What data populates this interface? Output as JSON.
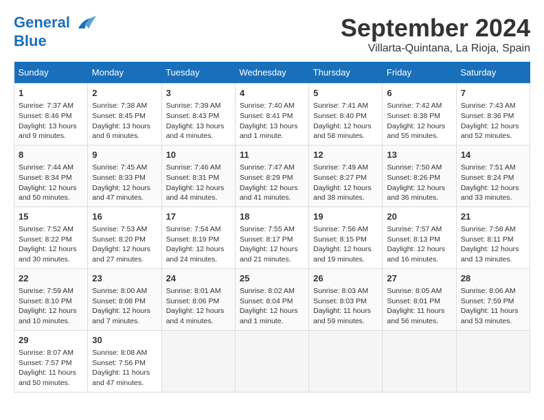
{
  "header": {
    "logo_line1": "General",
    "logo_line2": "Blue",
    "month_title": "September 2024",
    "location": "Villarta-Quintana, La Rioja, Spain"
  },
  "calendar": {
    "days_of_week": [
      "Sunday",
      "Monday",
      "Tuesday",
      "Wednesday",
      "Thursday",
      "Friday",
      "Saturday"
    ],
    "weeks": [
      [
        {
          "day": "1",
          "sunrise": "Sunrise: 7:37 AM",
          "sunset": "Sunset: 8:46 PM",
          "daylight": "Daylight: 13 hours and 9 minutes."
        },
        {
          "day": "2",
          "sunrise": "Sunrise: 7:38 AM",
          "sunset": "Sunset: 8:45 PM",
          "daylight": "Daylight: 13 hours and 6 minutes."
        },
        {
          "day": "3",
          "sunrise": "Sunrise: 7:39 AM",
          "sunset": "Sunset: 8:43 PM",
          "daylight": "Daylight: 13 hours and 4 minutes."
        },
        {
          "day": "4",
          "sunrise": "Sunrise: 7:40 AM",
          "sunset": "Sunset: 8:41 PM",
          "daylight": "Daylight: 13 hours and 1 minute."
        },
        {
          "day": "5",
          "sunrise": "Sunrise: 7:41 AM",
          "sunset": "Sunset: 8:40 PM",
          "daylight": "Daylight: 12 hours and 58 minutes."
        },
        {
          "day": "6",
          "sunrise": "Sunrise: 7:42 AM",
          "sunset": "Sunset: 8:38 PM",
          "daylight": "Daylight: 12 hours and 55 minutes."
        },
        {
          "day": "7",
          "sunrise": "Sunrise: 7:43 AM",
          "sunset": "Sunset: 8:36 PM",
          "daylight": "Daylight: 12 hours and 52 minutes."
        }
      ],
      [
        {
          "day": "8",
          "sunrise": "Sunrise: 7:44 AM",
          "sunset": "Sunset: 8:34 PM",
          "daylight": "Daylight: 12 hours and 50 minutes."
        },
        {
          "day": "9",
          "sunrise": "Sunrise: 7:45 AM",
          "sunset": "Sunset: 8:33 PM",
          "daylight": "Daylight: 12 hours and 47 minutes."
        },
        {
          "day": "10",
          "sunrise": "Sunrise: 7:46 AM",
          "sunset": "Sunset: 8:31 PM",
          "daylight": "Daylight: 12 hours and 44 minutes."
        },
        {
          "day": "11",
          "sunrise": "Sunrise: 7:47 AM",
          "sunset": "Sunset: 8:29 PM",
          "daylight": "Daylight: 12 hours and 41 minutes."
        },
        {
          "day": "12",
          "sunrise": "Sunrise: 7:49 AM",
          "sunset": "Sunset: 8:27 PM",
          "daylight": "Daylight: 12 hours and 38 minutes."
        },
        {
          "day": "13",
          "sunrise": "Sunrise: 7:50 AM",
          "sunset": "Sunset: 8:26 PM",
          "daylight": "Daylight: 12 hours and 36 minutes."
        },
        {
          "day": "14",
          "sunrise": "Sunrise: 7:51 AM",
          "sunset": "Sunset: 8:24 PM",
          "daylight": "Daylight: 12 hours and 33 minutes."
        }
      ],
      [
        {
          "day": "15",
          "sunrise": "Sunrise: 7:52 AM",
          "sunset": "Sunset: 8:22 PM",
          "daylight": "Daylight: 12 hours and 30 minutes."
        },
        {
          "day": "16",
          "sunrise": "Sunrise: 7:53 AM",
          "sunset": "Sunset: 8:20 PM",
          "daylight": "Daylight: 12 hours and 27 minutes."
        },
        {
          "day": "17",
          "sunrise": "Sunrise: 7:54 AM",
          "sunset": "Sunset: 8:19 PM",
          "daylight": "Daylight: 12 hours and 24 minutes."
        },
        {
          "day": "18",
          "sunrise": "Sunrise: 7:55 AM",
          "sunset": "Sunset: 8:17 PM",
          "daylight": "Daylight: 12 hours and 21 minutes."
        },
        {
          "day": "19",
          "sunrise": "Sunrise: 7:56 AM",
          "sunset": "Sunset: 8:15 PM",
          "daylight": "Daylight: 12 hours and 19 minutes."
        },
        {
          "day": "20",
          "sunrise": "Sunrise: 7:57 AM",
          "sunset": "Sunset: 8:13 PM",
          "daylight": "Daylight: 12 hours and 16 minutes."
        },
        {
          "day": "21",
          "sunrise": "Sunrise: 7:58 AM",
          "sunset": "Sunset: 8:11 PM",
          "daylight": "Daylight: 12 hours and 13 minutes."
        }
      ],
      [
        {
          "day": "22",
          "sunrise": "Sunrise: 7:59 AM",
          "sunset": "Sunset: 8:10 PM",
          "daylight": "Daylight: 12 hours and 10 minutes."
        },
        {
          "day": "23",
          "sunrise": "Sunrise: 8:00 AM",
          "sunset": "Sunset: 8:08 PM",
          "daylight": "Daylight: 12 hours and 7 minutes."
        },
        {
          "day": "24",
          "sunrise": "Sunrise: 8:01 AM",
          "sunset": "Sunset: 8:06 PM",
          "daylight": "Daylight: 12 hours and 4 minutes."
        },
        {
          "day": "25",
          "sunrise": "Sunrise: 8:02 AM",
          "sunset": "Sunset: 8:04 PM",
          "daylight": "Daylight: 12 hours and 1 minute."
        },
        {
          "day": "26",
          "sunrise": "Sunrise: 8:03 AM",
          "sunset": "Sunset: 8:03 PM",
          "daylight": "Daylight: 11 hours and 59 minutes."
        },
        {
          "day": "27",
          "sunrise": "Sunrise: 8:05 AM",
          "sunset": "Sunset: 8:01 PM",
          "daylight": "Daylight: 11 hours and 56 minutes."
        },
        {
          "day": "28",
          "sunrise": "Sunrise: 8:06 AM",
          "sunset": "Sunset: 7:59 PM",
          "daylight": "Daylight: 11 hours and 53 minutes."
        }
      ],
      [
        {
          "day": "29",
          "sunrise": "Sunrise: 8:07 AM",
          "sunset": "Sunset: 7:57 PM",
          "daylight": "Daylight: 11 hours and 50 minutes."
        },
        {
          "day": "30",
          "sunrise": "Sunrise: 8:08 AM",
          "sunset": "Sunset: 7:56 PM",
          "daylight": "Daylight: 11 hours and 47 minutes."
        },
        null,
        null,
        null,
        null,
        null
      ]
    ]
  }
}
